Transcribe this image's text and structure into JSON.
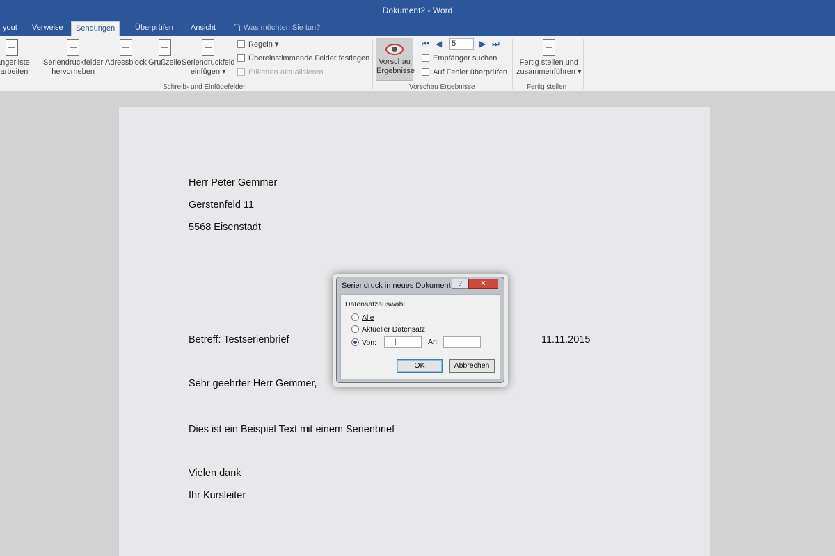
{
  "window": {
    "title": "Dokument2 - Word"
  },
  "tabs": [
    "yout",
    "Verweise",
    "Sendungen",
    "Überprüfen",
    "Ansicht"
  ],
  "active_tab": "Sendungen",
  "tell_me": "Was möchten Sie tun?",
  "ribbon": {
    "empfaenger": {
      "line1": "fängerliste",
      "line2": "earbeiten"
    },
    "hervorheben": {
      "line1": "Seriendruckfelder",
      "line2": "hervorheben"
    },
    "adressblock": "Adressblock",
    "grusszeile": "Grußzeile",
    "feld_einfuegen": {
      "line1": "Seriendruckfeld",
      "line2": "einfügen ▾"
    },
    "regeln": "Regeln ▾",
    "felder_festlegen": "Übereinstimmende Felder festlegen",
    "etiketten": "Etiketten aktualisieren",
    "group_schreib": "Schreib- und Einfügefelder",
    "vorschau": {
      "line1": "Vorschau",
      "line2": "Ergebnisse"
    },
    "record_value": "5",
    "empfaenger_suchen": "Empfänger suchen",
    "fehler_pruefen": "Auf Fehler überprüfen",
    "group_vorschau": "Vorschau Ergebnisse",
    "fertig": {
      "line1": "Fertig stellen und",
      "line2": "zusammenführen ▾"
    },
    "group_fertig": "Fertig stellen"
  },
  "document": {
    "address": [
      "Herr Peter Gemmer",
      "Gerstenfeld 11",
      "5568 Eisenstadt"
    ],
    "subject": "Betreff: Testserienbrief",
    "date": "11.11.2015",
    "greeting": "Sehr geehrter Herr Gemmer,",
    "body_a": "Dies ist ein Beispiel Text m",
    "body_b": "it einem Serienbrief",
    "closing1": "Vielen dank",
    "closing2": "Ihr Kursleiter"
  },
  "dialog": {
    "title": "Seriendruck in neues Dokument",
    "help": "?",
    "close": "✕",
    "group": "Datensatzauswahl",
    "opt_all": "Alle",
    "opt_current": "Aktueller Datensatz",
    "opt_from": "Von:",
    "to_label": "An:",
    "from_value": "",
    "to_value": "",
    "ok": "OK",
    "cancel": "Abbrechen"
  }
}
